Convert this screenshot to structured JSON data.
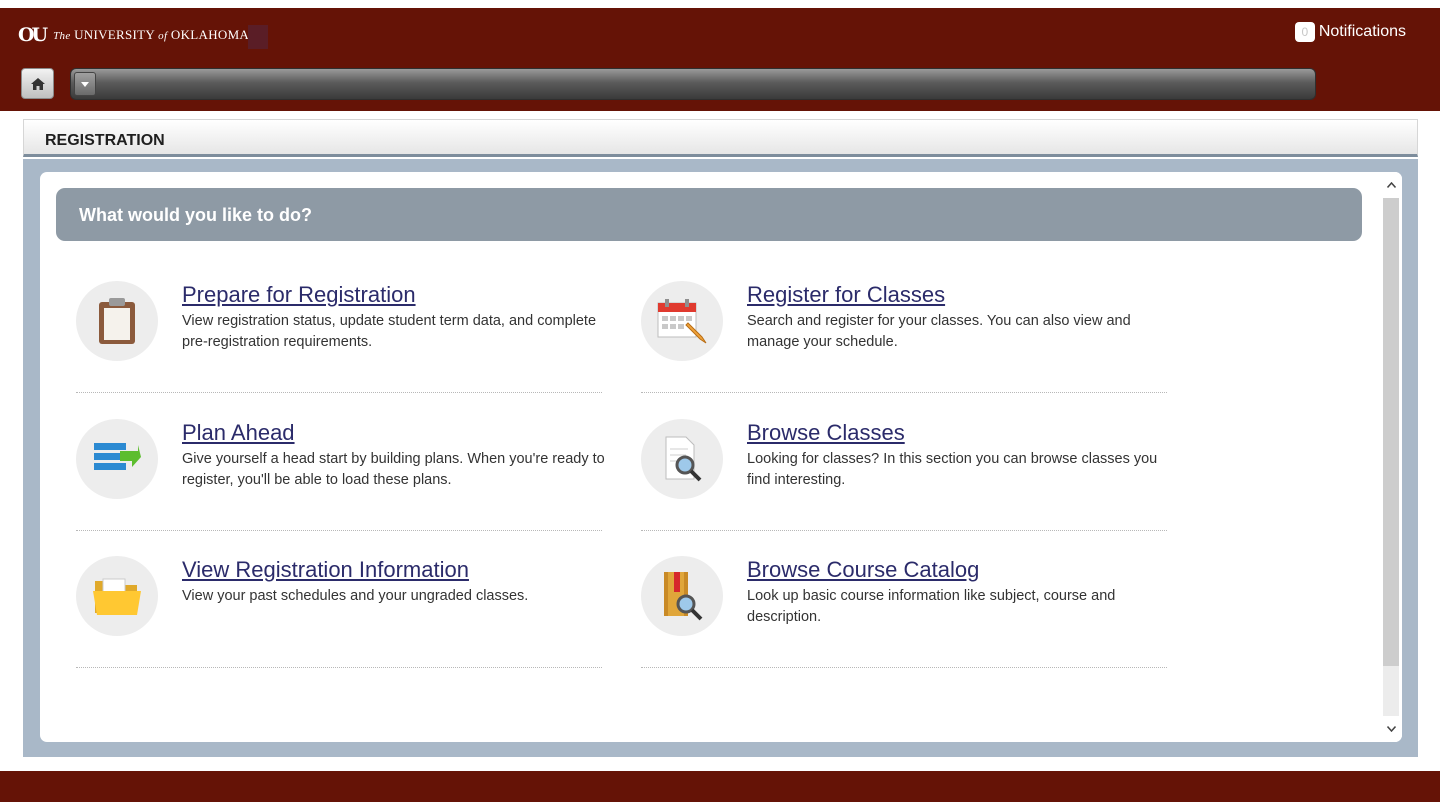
{
  "header": {
    "logo_mark": "OU",
    "logo_prefix": "The",
    "logo_university": "UNIVERSITY",
    "logo_of": "of",
    "logo_name": "OKLAHOMA",
    "notifications_count": "0",
    "notifications_label": "Notifications"
  },
  "nav": {
    "home_icon": "home-icon",
    "dropdown_icon": "caret-down-icon"
  },
  "panel": {
    "title": "REGISTRATION",
    "banner": "What would you like to do?"
  },
  "items": [
    {
      "title": "Prepare for Registration",
      "description": "View registration status, update student term data, and complete pre-registration requirements.",
      "icon": "clipboard-icon"
    },
    {
      "title": "Register for Classes",
      "description": "Search and register for your classes. You can also view and manage your schedule.",
      "icon": "calendar-pencil-icon"
    },
    {
      "title": "Plan Ahead",
      "description": "Give yourself a head start by building plans. When you're ready to register, you'll be able to load these plans.",
      "icon": "list-arrow-icon"
    },
    {
      "title": "Browse Classes",
      "description": "Looking for classes? In this section you can browse classes you find interesting.",
      "icon": "document-search-icon"
    },
    {
      "title": "View Registration Information",
      "description": "View your past schedules and your ungraded classes.",
      "icon": "folder-icon"
    },
    {
      "title": "Browse Course Catalog",
      "description": "Look up basic course information like subject, course and description.",
      "icon": "book-search-icon"
    }
  ],
  "colors": {
    "brand": "#651306",
    "banner": "#8e9aa5",
    "link": "#2b2b6a",
    "panel_frame": "#a9b8c8"
  }
}
